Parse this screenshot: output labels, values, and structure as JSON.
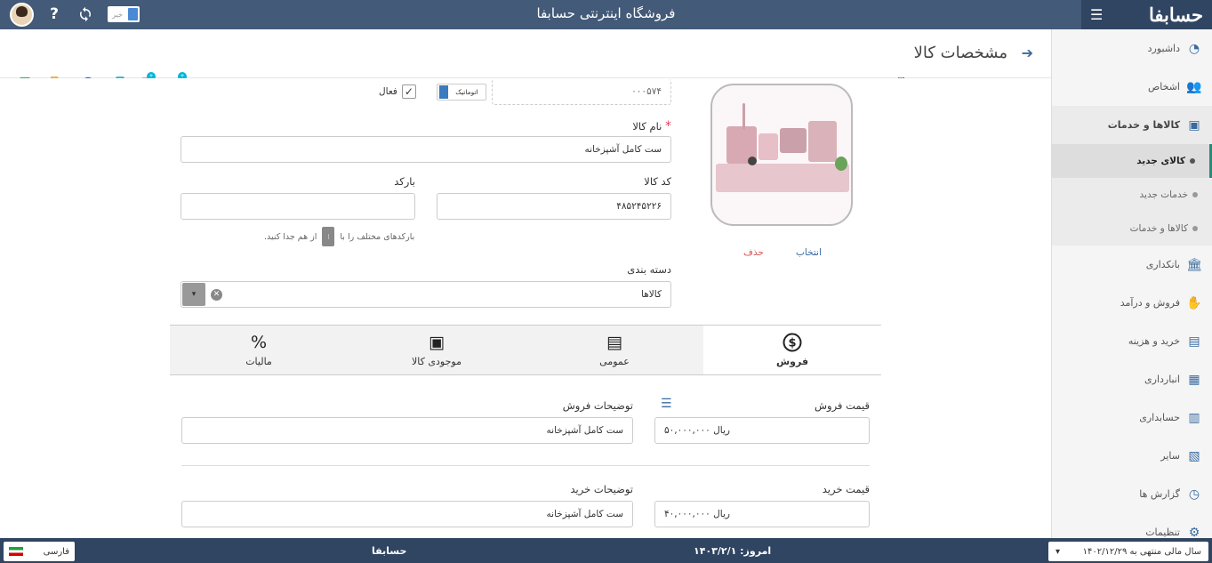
{
  "topbar": {
    "title": "فروشگاه اینترنتی حسابفا",
    "toggle_label": "خیر",
    "help_icon": "question-icon",
    "sync_icon": "sync-icon"
  },
  "brand": {
    "logo_text": "حسابفا",
    "menu_icon": "menu-icon"
  },
  "sidebar": {
    "items": [
      {
        "label": "داشبورد",
        "icon": "dashboard-icon"
      },
      {
        "label": "اشخاص",
        "icon": "people-icon"
      },
      {
        "label": "کالاها و خدمات",
        "icon": "box-icon"
      },
      {
        "label": "بانکداری",
        "icon": "bank-icon"
      },
      {
        "label": "فروش و درآمد",
        "icon": "sales-icon"
      },
      {
        "label": "خرید و هزینه",
        "icon": "purchase-icon"
      },
      {
        "label": "انبارداری",
        "icon": "warehouse-icon"
      },
      {
        "label": "حسابداری",
        "icon": "accounting-icon"
      },
      {
        "label": "سایر",
        "icon": "other-icon"
      },
      {
        "label": "گزارش ها",
        "icon": "reports-icon"
      },
      {
        "label": "تنظیمات",
        "icon": "settings-icon"
      }
    ],
    "sub_items": [
      {
        "label": "کالای جدید",
        "active": true
      },
      {
        "label": "خدمات جدید",
        "active": false
      },
      {
        "label": "کالاها و خدمات",
        "active": false
      }
    ]
  },
  "page": {
    "title": "مشخصات کالا"
  },
  "form": {
    "code_value": "۰۰۰۵۷۴",
    "auto_label": "اتوماتیک",
    "active_label": "فعال",
    "name_label": "نام کالا",
    "name_value": "ست کامل آشپزخانه",
    "product_code_label": "کد کالا",
    "product_code_value": "۴۸۵۲۴۵۲۲۶",
    "barcode_label": "بارکد",
    "barcode_value": "",
    "barcode_hint_a": "بارکدهای مختلف را با",
    "barcode_hint_b": "از هم جدا کنید.",
    "category_label": "دسته بندی",
    "category_value": "کالاها",
    "select_label": "انتخاب",
    "delete_label": "حذف"
  },
  "tabs": [
    {
      "label": "فروش",
      "icon": "dollar-icon",
      "active": true
    },
    {
      "label": "عمومی",
      "icon": "message-icon",
      "active": false
    },
    {
      "label": "موجودی کالا",
      "icon": "inventory-icon",
      "active": false
    },
    {
      "label": "مالیات",
      "icon": "percent-icon",
      "active": false
    }
  ],
  "sale": {
    "price_label": "قیمت فروش",
    "price_value": "۵۰,۰۰۰,۰۰۰",
    "currency": "ریال",
    "desc_label": "توضیحات فروش",
    "desc_value": "ست کامل آشپزخانه"
  },
  "purchase": {
    "price_label": "قیمت خرید",
    "price_value": "۴۰,۰۰۰,۰۰۰",
    "currency": "ریال",
    "desc_label": "توضیحات خرید",
    "desc_value": "ست کامل آشپزخانه"
  },
  "footer": {
    "language": "فارسی",
    "brand": "حسابفا",
    "today": "امروز: ۱۴۰۳/۲/۱",
    "fiscal_year": "سال مالی منتهی به ۱۴۰۲/۱۲/۲۹"
  },
  "colors": {
    "topbar": "#435a78",
    "accent": "#3a6b9f",
    "active_tab_border": "#2a8a7a"
  }
}
